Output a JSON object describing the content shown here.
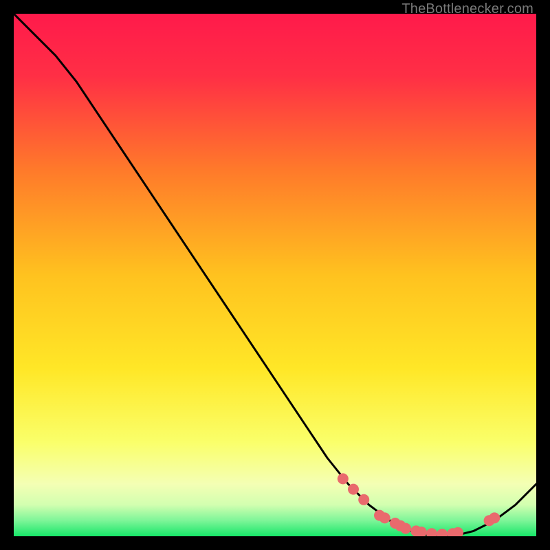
{
  "watermark": "TheBottlenecker.com",
  "colors": {
    "top": "#ff1a4b",
    "mid": "#ffd500",
    "lightband": "#faff9e",
    "green": "#17e669",
    "line": "#000000",
    "marker": "#e96a6d",
    "frame": "#000000"
  },
  "chart_data": {
    "type": "line",
    "title": "",
    "xlabel": "",
    "ylabel": "",
    "xlim": [
      0,
      100
    ],
    "ylim": [
      0,
      100
    ],
    "series": [
      {
        "name": "bottleneck-curve",
        "x": [
          0,
          4,
          8,
          12,
          16,
          20,
          24,
          28,
          32,
          36,
          40,
          44,
          48,
          52,
          56,
          60,
          64,
          68,
          72,
          76,
          80,
          84,
          88,
          92,
          96,
          100
        ],
        "y": [
          100,
          96,
          92,
          87,
          81,
          75,
          69,
          63,
          57,
          51,
          45,
          39,
          33,
          27,
          21,
          15,
          10,
          6,
          3,
          1,
          0,
          0,
          1,
          3,
          6,
          10
        ]
      }
    ],
    "markers": {
      "name": "highlight-points",
      "x": [
        63,
        65,
        67,
        70,
        71,
        73,
        74,
        75,
        77,
        78,
        80,
        82,
        84,
        85,
        91,
        92
      ],
      "y": [
        11,
        9,
        7,
        4,
        3.5,
        2.5,
        2,
        1.5,
        1,
        0.8,
        0.5,
        0.4,
        0.5,
        0.7,
        3,
        3.5
      ]
    }
  }
}
